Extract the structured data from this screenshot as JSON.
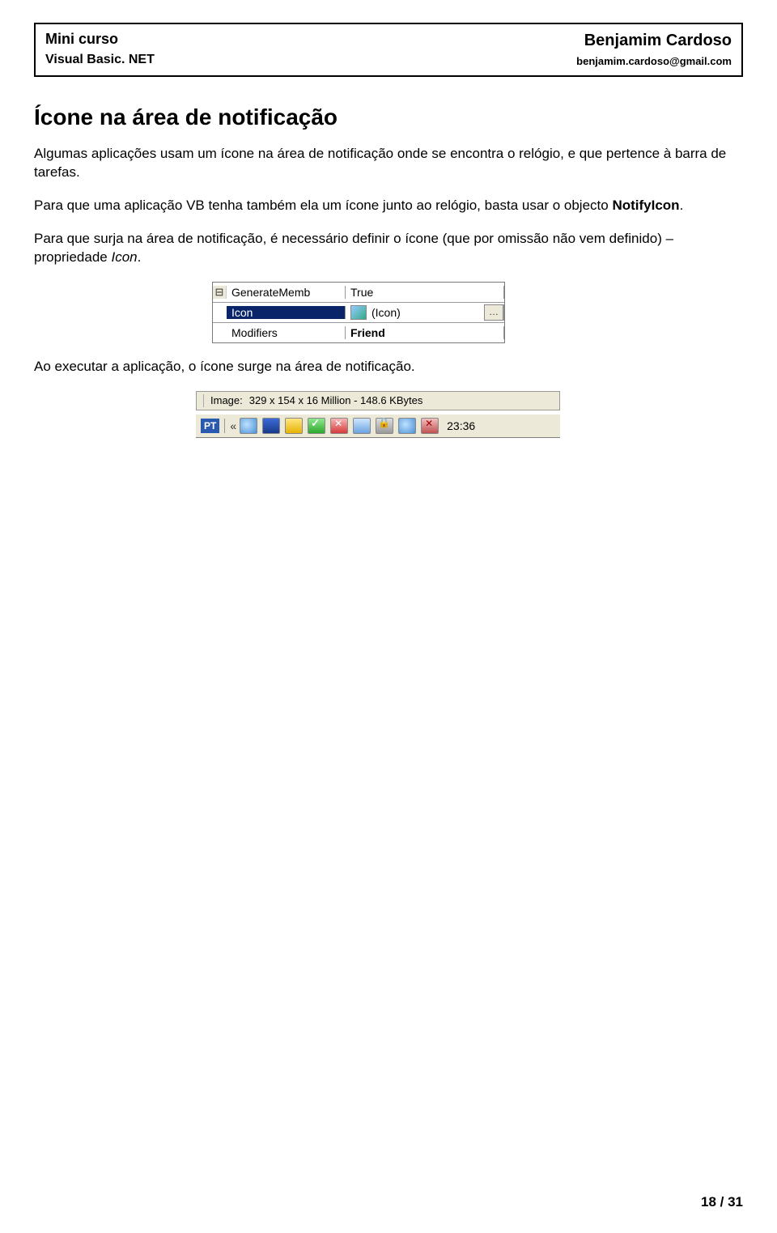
{
  "header": {
    "left_title": "Mini curso",
    "left_subtitle": "Visual Basic. NET",
    "right_title": "Benjamim Cardoso",
    "right_subtitle": "benjamim.cardoso@gmail.com"
  },
  "section_title": "Ícone na área de notificação",
  "para1_a": "Algumas aplicações usam um ícone na área de notificação onde se encontra o relógio, e que pertence à barra de tarefas.",
  "para2_a": "Para que uma aplicação VB tenha também ela um ícone junto ao relógio, basta usar o objecto ",
  "para2_b": "NotifyIcon",
  "para2_c": ".",
  "para3_a": "Para que surja na área de notificação, é necessário definir o ícone (que por omissão não vem definido) – propriedade ",
  "para3_b": "Icon",
  "para3_c": ".",
  "propgrid": {
    "rows": [
      {
        "name": "GenerateMemb",
        "value": "True"
      },
      {
        "name": "Icon",
        "value": "(Icon)"
      },
      {
        "name": "Modifiers",
        "value": "Friend"
      }
    ]
  },
  "para4": "Ao executar a aplicação, o ícone surge na área de notificação.",
  "statusbar": {
    "label": "Image:",
    "text": "329 x 154 x 16 Million - 148.6 KBytes"
  },
  "taskbar": {
    "lang": "PT",
    "arrows": "«",
    "clock": "23:36"
  },
  "pagenum": "18 / 31"
}
